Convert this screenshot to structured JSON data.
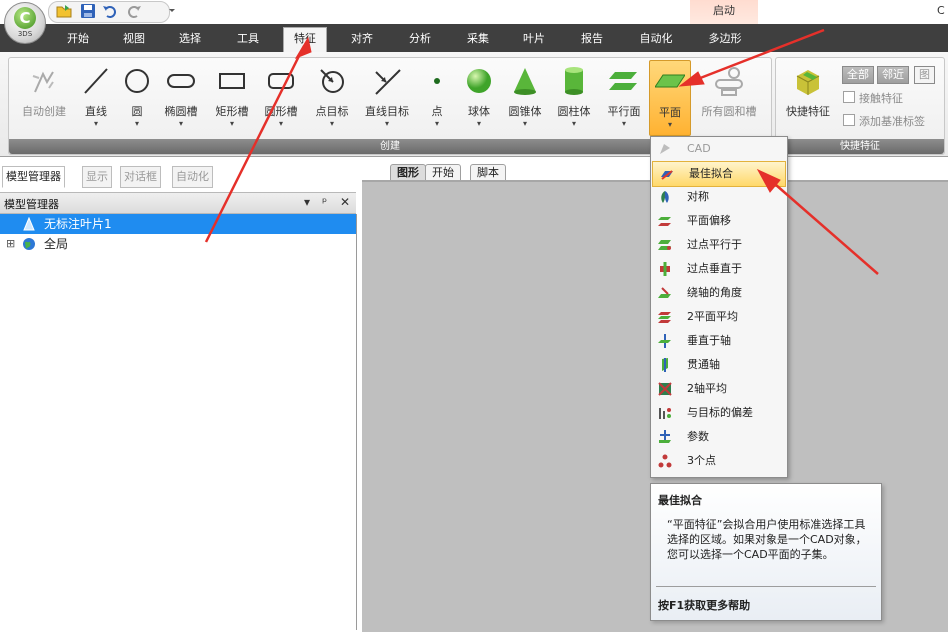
{
  "app": {
    "logo_letter": "C",
    "logo_sub": "3DS"
  },
  "contextual_tab": "启动",
  "title_right": "C",
  "tabs": [
    "开始",
    "视图",
    "选择",
    "工具",
    "特征",
    "对齐",
    "分析",
    "采集",
    "叶片",
    "报告",
    "自动化",
    "多边形"
  ],
  "active_tab": "特征",
  "ribbon": {
    "create_group_label": "创建",
    "quick_group_label": "快捷特征",
    "buttons": [
      "自动创建",
      "直线",
      "圆",
      "椭圆槽",
      "矩形槽",
      "圆形槽",
      "点目标",
      "直线目标",
      "点",
      "球体",
      "圆锥体",
      "圆柱体",
      "平行面",
      "平面",
      "所有圆和槽"
    ],
    "quick_button": "快捷特征",
    "quick_tabs": [
      "全部",
      "邻近",
      "图"
    ],
    "quick_checks": [
      "接触特征",
      "添加基准标签"
    ]
  },
  "left_panel": {
    "tabs": [
      "模型管理器",
      "显示",
      "对话框",
      "自动化"
    ],
    "header": "模型管理器",
    "controls": [
      "▾",
      "ᵖ",
      "✕"
    ],
    "tree": [
      {
        "label": "无标注叶片1",
        "selected": true,
        "expander": ""
      },
      {
        "label": "全局",
        "selected": false,
        "expander": "⊞"
      }
    ]
  },
  "doc_tabs": [
    "图形",
    "开始",
    "脚本"
  ],
  "plane_menu": {
    "items": [
      {
        "label": "CAD",
        "disabled": true
      },
      {
        "label": "最佳拟合",
        "hover": true
      },
      {
        "label": "对称"
      },
      {
        "label": "平面偏移"
      },
      {
        "label": "过点平行于"
      },
      {
        "label": "过点垂直于"
      },
      {
        "label": "绕轴的角度"
      },
      {
        "label": "2平面平均"
      },
      {
        "label": "垂直于轴"
      },
      {
        "label": "贯通轴"
      },
      {
        "label": "2轴平均"
      },
      {
        "label": "与目标的偏差"
      },
      {
        "label": "参数"
      },
      {
        "label": "3个点"
      }
    ]
  },
  "tooltip": {
    "title": "最佳拟合",
    "body": "“平面特征”会拟合用户使用标准选择工具选择的区域。如果对象是一个CAD对象，您可以选择一个CAD平面的子集。",
    "footer": "按F1获取更多帮助"
  },
  "colors": {
    "accent_arrow": "#e5302a",
    "selection": "#1f8cf0",
    "tab_bar": "#3f3f3f",
    "highlight": "#ffb232"
  }
}
